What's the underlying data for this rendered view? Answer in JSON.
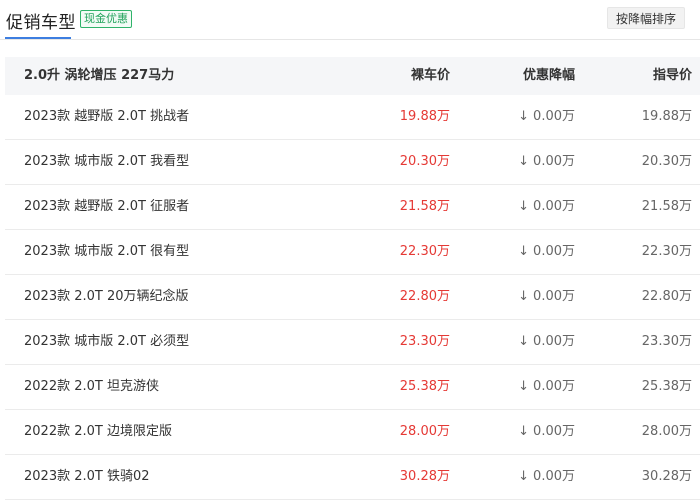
{
  "header": {
    "title": "促销车型",
    "badge": "现金优惠",
    "sort_button": "按降幅排序"
  },
  "table": {
    "group_label": "2.0升 涡轮增压 227马力",
    "columns": {
      "price": "裸车价",
      "discount": "优惠降幅",
      "guide": "指导价"
    },
    "rows": [
      {
        "name": "2023款 越野版 2.0T 挑战者",
        "price": "19.88万",
        "discount": "0.00万",
        "guide": "19.88万"
      },
      {
        "name": "2023款 城市版 2.0T 我看型",
        "price": "20.30万",
        "discount": "0.00万",
        "guide": "20.30万"
      },
      {
        "name": "2023款 越野版 2.0T 征服者",
        "price": "21.58万",
        "discount": "0.00万",
        "guide": "21.58万"
      },
      {
        "name": "2023款 城市版 2.0T 很有型",
        "price": "22.30万",
        "discount": "0.00万",
        "guide": "22.30万"
      },
      {
        "name": "2023款 2.0T 20万辆纪念版",
        "price": "22.80万",
        "discount": "0.00万",
        "guide": "22.80万"
      },
      {
        "name": "2023款 城市版 2.0T 必须型",
        "price": "23.30万",
        "discount": "0.00万",
        "guide": "23.30万"
      },
      {
        "name": "2022款 2.0T 坦克游侠",
        "price": "25.38万",
        "discount": "0.00万",
        "guide": "25.38万"
      },
      {
        "name": "2022款 2.0T 边境限定版",
        "price": "28.00万",
        "discount": "0.00万",
        "guide": "28.00万"
      },
      {
        "name": "2023款 2.0T 铁骑02",
        "price": "30.28万",
        "discount": "0.00万",
        "guide": "30.28万"
      }
    ]
  },
  "icons": {
    "discount_arrow": "arrow-down-icon",
    "discount_arrow_glyph": "↓"
  },
  "colors": {
    "price_red": "#e53935",
    "badge_green": "#22a35c",
    "tab_blue": "#3d7ee0"
  }
}
